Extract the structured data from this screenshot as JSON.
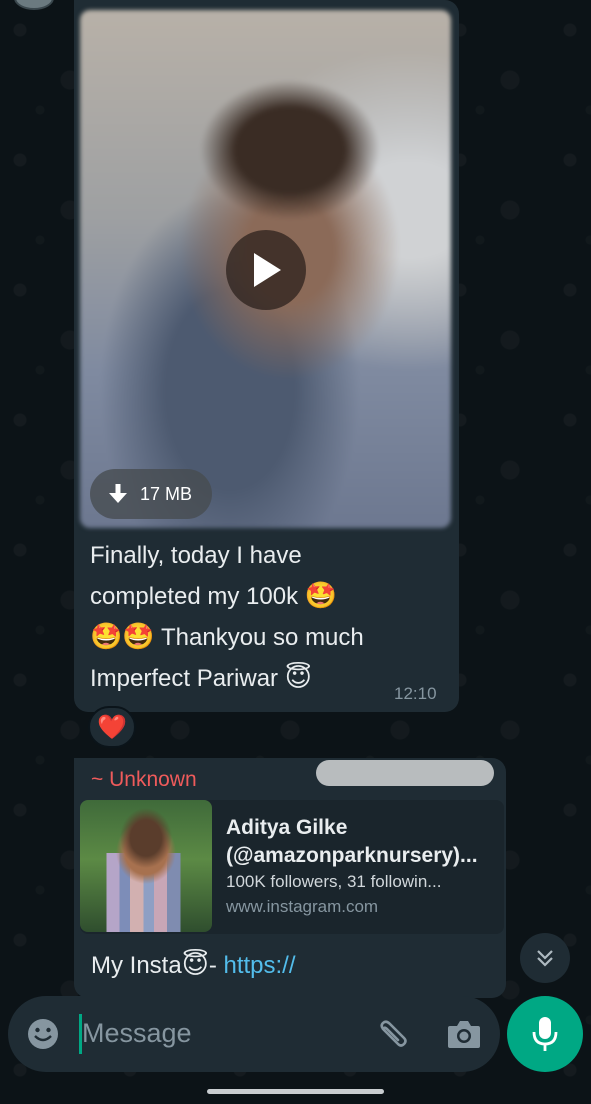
{
  "video_message": {
    "size_label": "17 MB",
    "text_line1": "Finally, today I have",
    "text_line2": "completed my 100k",
    "text_line3": "Thankyou so much",
    "text_line4": "Imperfect Pariwar",
    "emoji_star": "🤩",
    "emoji_halo": "😇",
    "time": "12:10",
    "reaction": "❤️"
  },
  "link_message": {
    "sender": "~ Unknown",
    "preview": {
      "title": "Aditya Gilke (@amazonparknursery)...",
      "subtitle": "100K followers, 31 followin...",
      "url": "www.instagram.com"
    },
    "text_prefix": "My Insta",
    "emoji": "😇",
    "text_dash": "- ",
    "link_text": "https://"
  },
  "composer": {
    "placeholder": "Message"
  },
  "icons": {
    "download": "download-arrow-icon",
    "play": "play-icon",
    "emoji": "emoji-icon",
    "attach": "paperclip-icon",
    "camera": "camera-icon",
    "mic": "microphone-icon",
    "scroll": "double-chevron-down-icon"
  },
  "colors": {
    "accent": "#00a884",
    "bubble": "#1f2c34",
    "sender_name": "#ef5b5b",
    "link": "#53bdeb"
  }
}
